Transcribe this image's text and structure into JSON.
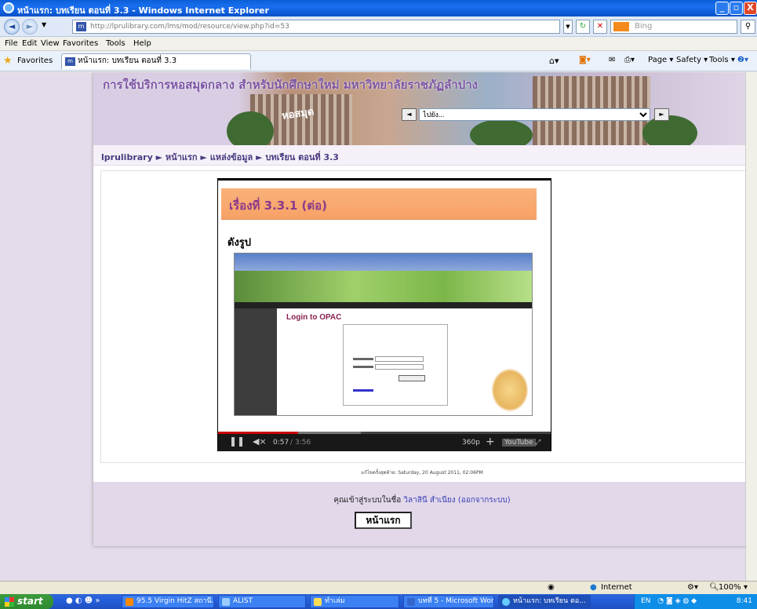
{
  "window": {
    "title": "หน้าแรก: บทเรียน ตอนที่ 3.3 - Windows Internet Explorer",
    "minimize": "_",
    "restore": "▫",
    "close": "X"
  },
  "address_bar": {
    "url": "http://lprulibrary.com/lms/mod/resource/view.php?id=53",
    "search_placeholder": "Bing"
  },
  "menu": [
    "File",
    "Edit",
    "View",
    "Favorites",
    "Tools",
    "Help"
  ],
  "favorites_bar": {
    "favorites_label": "Favorites",
    "tab_title": "หน้าแรก: บทเรียน ตอนที่ 3.3",
    "tools": [
      "Page ▾",
      "Safety ▾",
      "Tools ▾"
    ]
  },
  "site": {
    "banner_title": "การใช้บริการหอสมุดกลาง สำหรับนักศึกษาใหม่ มหาวิทยาลัยราชภัฏลำปาง",
    "banner_sign": "หอสมุด",
    "jump_select_value": "ไปยัง...",
    "breadcrumb": [
      "lprulibrary",
      "หน้าแรก",
      "แหล่งข้อมูล",
      "บทเรียน ตอนที่ 3.3"
    ],
    "breadcrumb_separator": "►"
  },
  "video": {
    "heading": "เรื่องที่ 3.3.1 (ต่อ)",
    "subheading": "ดังรูป",
    "opac_title": "Login to OPAC",
    "time_current": "0:57",
    "time_total": "3:56",
    "quality": "360p",
    "plus": "+",
    "youtube": "YouTube",
    "progress_fraction": 0.24
  },
  "page_footer": {
    "updated": "แก้ไขครั้งสุดท้าย: Saturday, 20 August 2011, 02:06PM",
    "login_prefix": "คุณเข้าสู่ระบบในชื่อ",
    "user_name": "วิลาสินี สำเนียง",
    "logout": "(ออกจากระบบ)",
    "home_button": "หน้าแรก"
  },
  "status_bar": {
    "zone": "Internet",
    "zoom": "100%"
  },
  "taskbar": {
    "start": "start",
    "tasks": [
      "95.5 Virgin HitZ สถานี...",
      "ALIST",
      "ทำเล่ม",
      "บทที่ 5 - Microsoft Word",
      "หน้าแรก: บทเรียน ตอ..."
    ],
    "lang": "EN",
    "clock": "8:41"
  }
}
